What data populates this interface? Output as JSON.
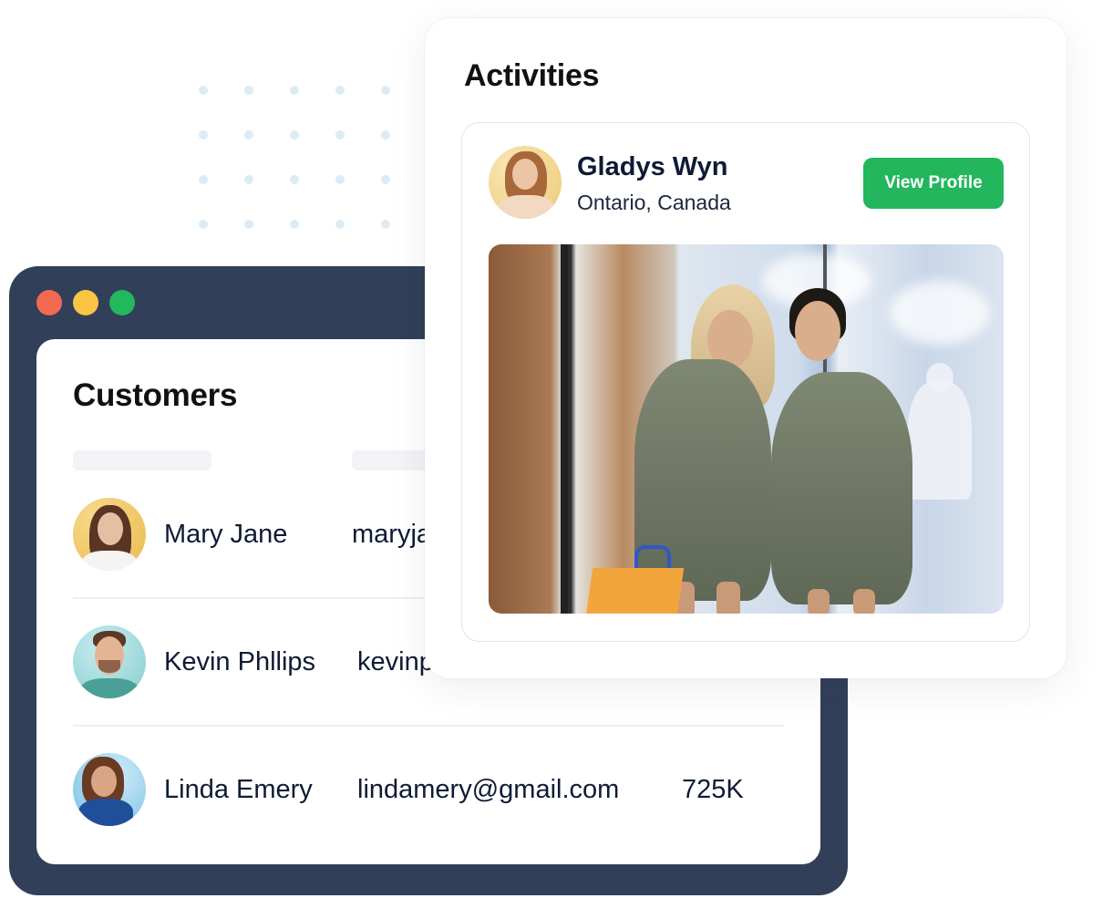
{
  "decor": {
    "dot_grid": {
      "rows": 4,
      "cols": 5,
      "color": "#dcebf4"
    }
  },
  "customers_window": {
    "traffic_lights": [
      {
        "name": "close",
        "color": "#f26a50"
      },
      {
        "name": "minimize",
        "color": "#f8c544"
      },
      {
        "name": "maximize",
        "color": "#22b85c"
      }
    ],
    "frame_color": "#323f59",
    "title": "Customers",
    "rows": [
      {
        "name": "Mary Jane",
        "email": "maryjane@gmail.com",
        "value": "",
        "avatar": "mary-jane-avatar"
      },
      {
        "name": "Kevin Phllips",
        "email": "kevinphillips@gmail.com",
        "value": "",
        "avatar": "kevin-phillips-avatar"
      },
      {
        "name": "Linda Emery",
        "email": "lindamery@gmail.com",
        "value": "725K",
        "avatar": "linda-emery-avatar"
      }
    ]
  },
  "activities": {
    "title": "Activities",
    "profile": {
      "name": "Gladys Wyn",
      "location": "Ontario, Canada",
      "button_label": "View Profile",
      "button_color": "#23b65c",
      "photo": "two-women-shopping-photo"
    }
  }
}
